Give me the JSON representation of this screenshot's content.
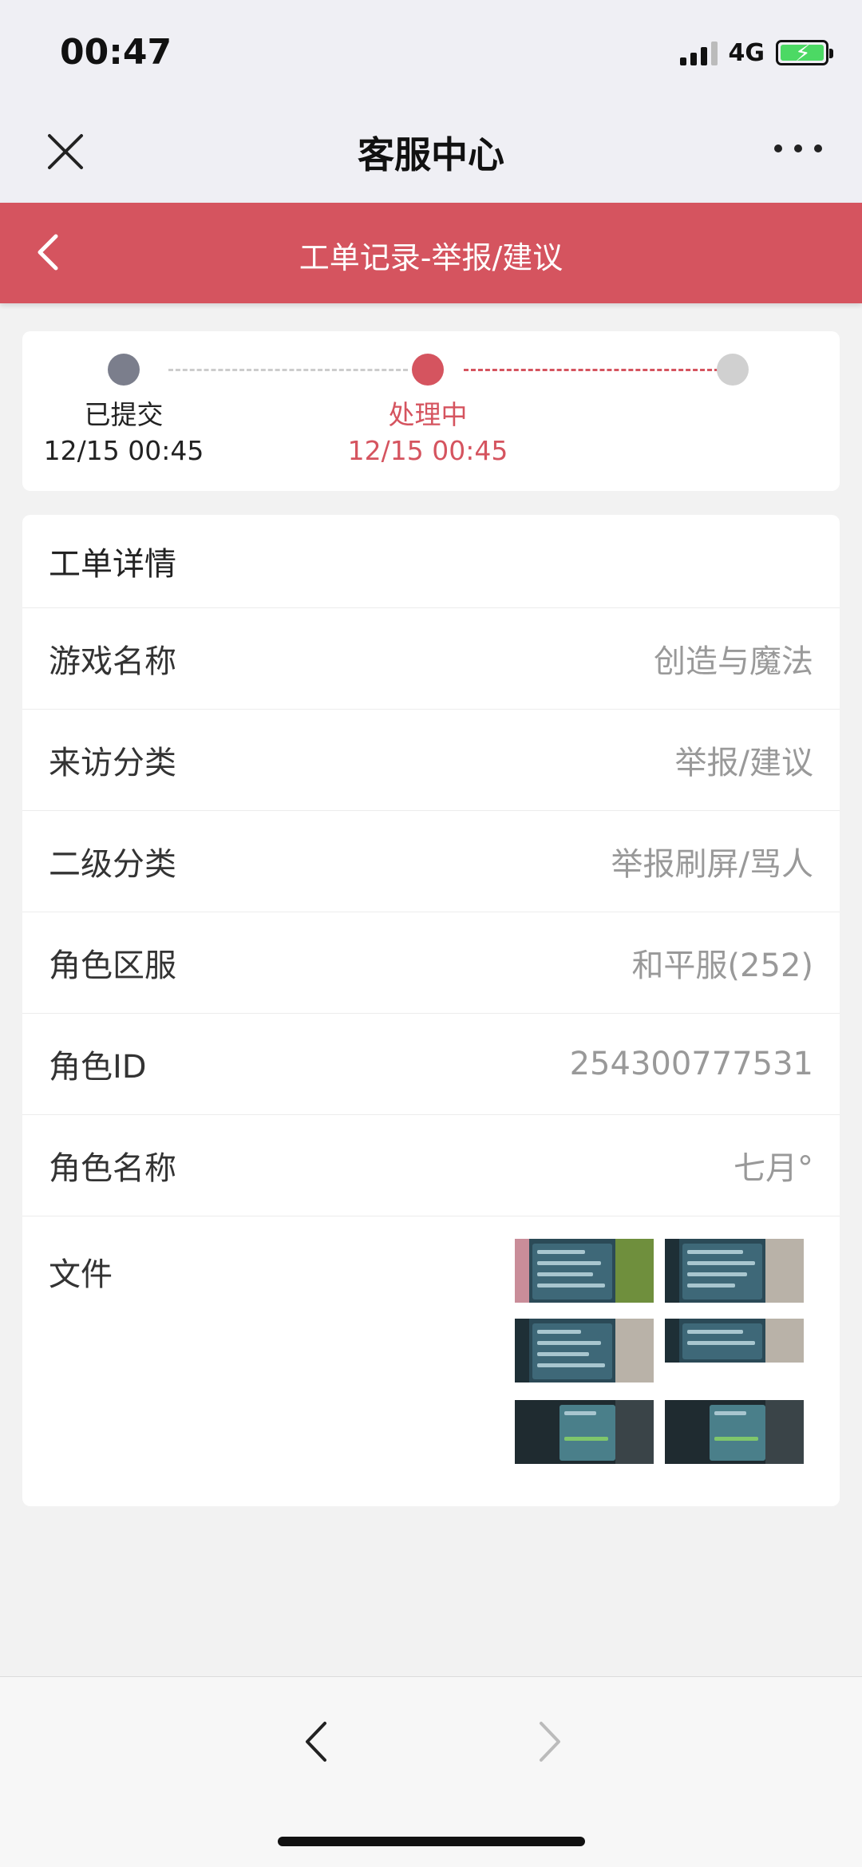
{
  "status_bar": {
    "time": "00:47",
    "network": "4G"
  },
  "nav": {
    "title": "客服中心"
  },
  "header": {
    "title": "工单记录-举报/建议"
  },
  "progress": {
    "steps": [
      {
        "label": "已提交",
        "date": "12/15 00:45"
      },
      {
        "label": "处理中",
        "date": "12/15 00:45"
      },
      {
        "label": "",
        "date": ""
      }
    ]
  },
  "details": {
    "title": "工单详情",
    "rows": [
      {
        "label": "游戏名称",
        "value": "创造与魔法"
      },
      {
        "label": "来访分类",
        "value": "举报/建议"
      },
      {
        "label": "二级分类",
        "value": "举报刷屏/骂人"
      },
      {
        "label": "角色区服",
        "value": "和平服(252)"
      },
      {
        "label": "角色ID",
        "value": "254300777531"
      },
      {
        "label": "角色名称",
        "value": "七月°"
      }
    ],
    "files_label": "文件"
  },
  "colors": {
    "accent": "#d5545f",
    "done_dot": "#7b7e8c",
    "pending_dot": "#d0d0d0"
  },
  "icons": {
    "close": "close-icon",
    "more": "more-icon",
    "back": "chevron-left-icon",
    "forward": "chevron-right-icon"
  }
}
